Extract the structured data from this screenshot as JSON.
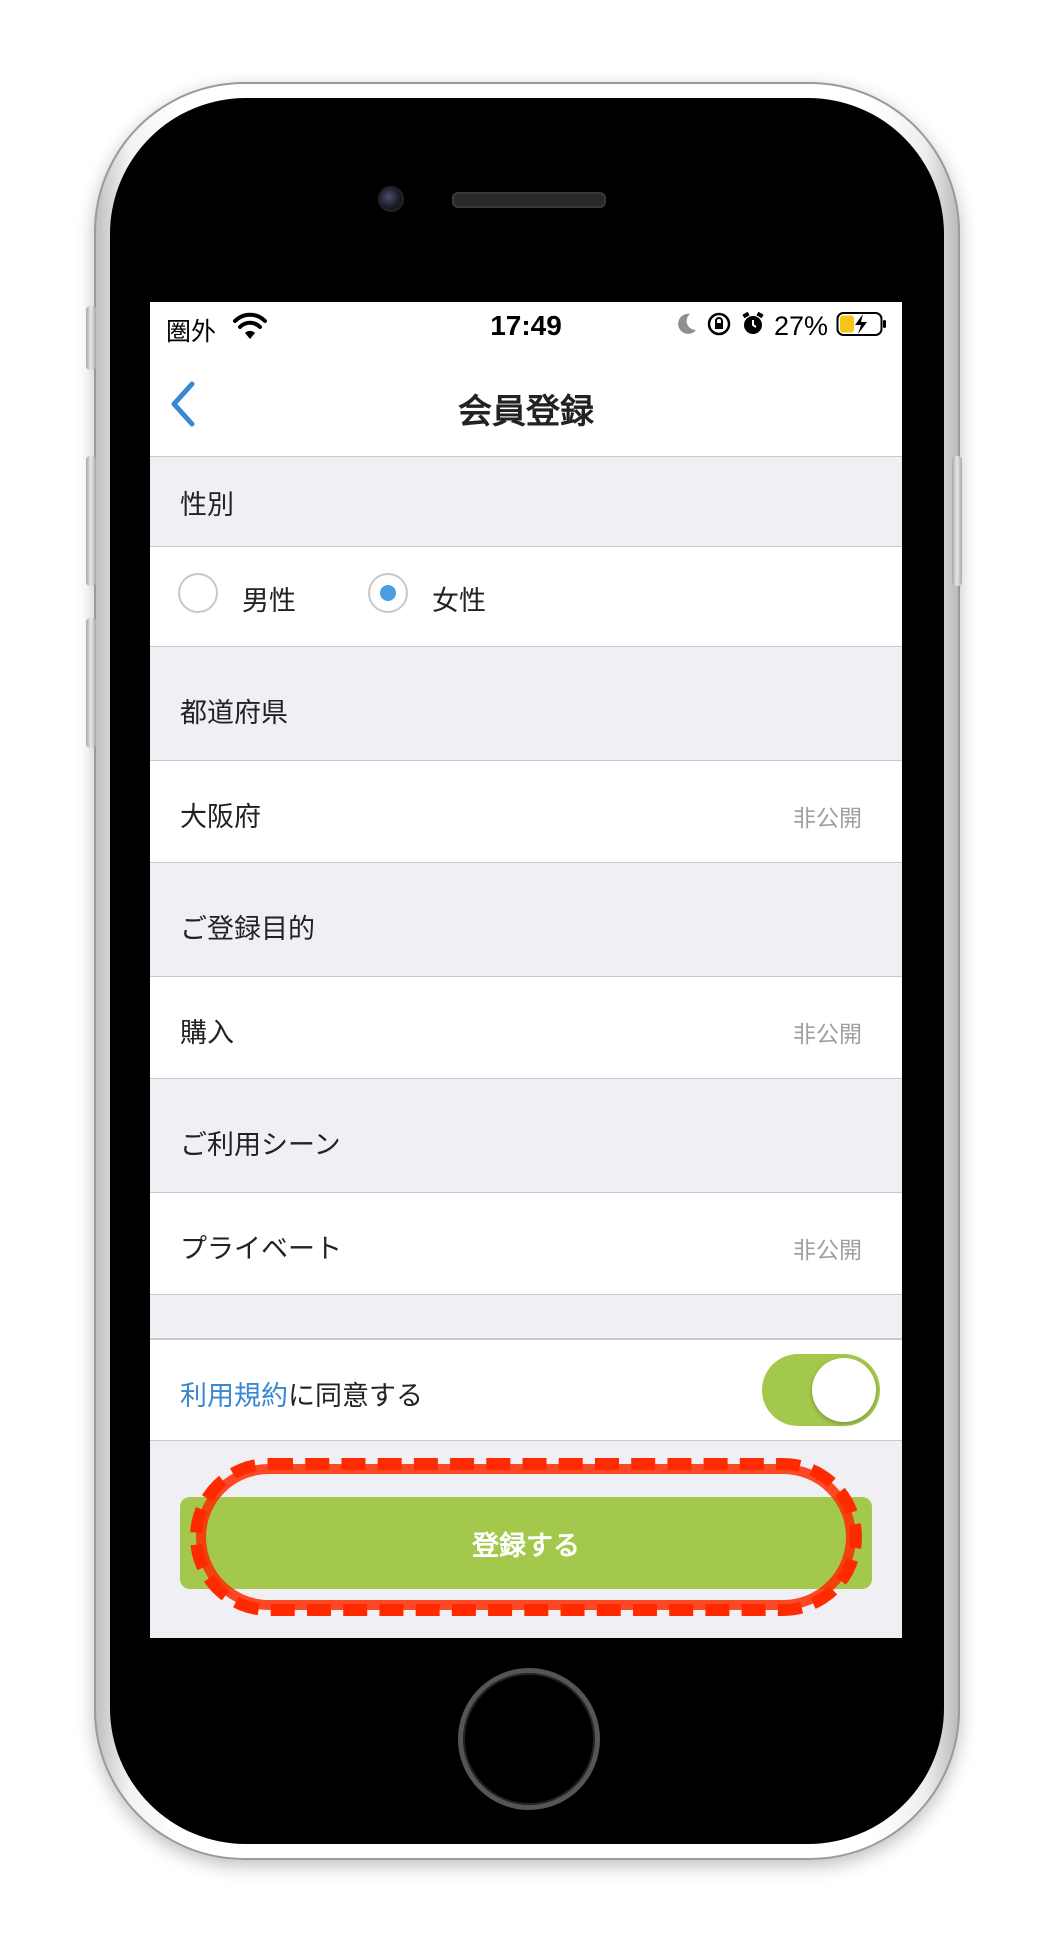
{
  "status_bar": {
    "carrier": "圏外",
    "time": "17:49",
    "battery_percent": "27%",
    "icons": [
      "wifi-icon",
      "moon-icon",
      "orientation-lock-icon",
      "alarm-icon",
      "battery-charging-icon"
    ]
  },
  "nav": {
    "title": "会員登録",
    "back_icon": "chevron-left-icon"
  },
  "form": {
    "gender": {
      "header": "性別",
      "options": [
        {
          "label": "男性",
          "selected": false
        },
        {
          "label": "女性",
          "selected": true
        }
      ]
    },
    "prefecture": {
      "header": "都道府県",
      "value": "大阪府",
      "privacy": "非公開"
    },
    "purpose": {
      "header": "ご登録目的",
      "value": "購入",
      "privacy": "非公開"
    },
    "scene": {
      "header": "ご利用シーン",
      "value": "プライベート",
      "privacy": "非公開"
    },
    "terms": {
      "link": "利用規約",
      "text": "に同意する",
      "toggle_on": true
    },
    "submit_label": "登録する"
  },
  "colors": {
    "accent_green": "#a4c84b",
    "link_blue": "#3a87d4",
    "radio_blue": "#4a9de0",
    "highlight_red": "#ff2a00",
    "section_bg": "#efeff4"
  }
}
